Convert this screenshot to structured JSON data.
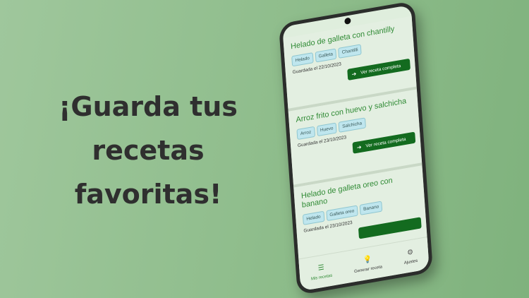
{
  "headline": [
    "¡Guarda tus",
    "recetas",
    "favoritas!"
  ],
  "recipes": [
    {
      "title": "Helado de galleta con chantilly",
      "tags": [
        "Helado",
        "Galleta",
        "Chantilli"
      ],
      "saved": "Guardada el 22/10/2023",
      "button": "Ver receta completa"
    },
    {
      "title": "Arroz frito con huevo y salchicha",
      "tags": [
        "Arroz",
        "Huevo",
        "Salchicha"
      ],
      "saved": "Guardada el 23/10/2023",
      "button": "Ver receta completa"
    },
    {
      "title": "Helado de galleta oreo con banano",
      "tags": [
        "Helado",
        "Galleta oreo",
        "Banano"
      ],
      "saved": "Guardada el 23/10/2023",
      "button": ""
    }
  ],
  "nav": [
    {
      "label": "Mis recetas",
      "icon": "list-icon",
      "active": true
    },
    {
      "label": "Generar receta",
      "icon": "lightbulb-icon",
      "active": false
    },
    {
      "label": "Ajustes",
      "icon": "gear-icon",
      "active": false
    }
  ]
}
